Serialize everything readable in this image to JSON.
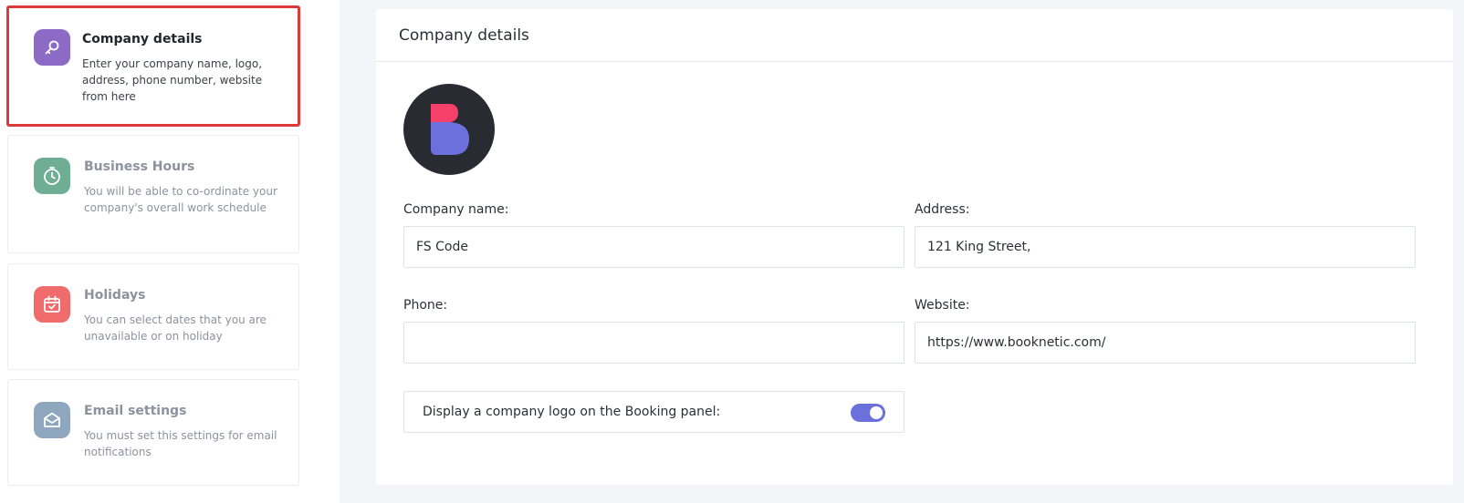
{
  "sidebar": {
    "items": [
      {
        "title": "Company details",
        "description": "Enter your company name, logo, address, phone number, website from here",
        "icon": "key-icon",
        "icon_color": "#8c6ac6",
        "active": true
      },
      {
        "title": "Business Hours",
        "description": "You will be able to co-ordinate your company's overall work schedule",
        "icon": "clock-icon",
        "icon_color": "#6fae94",
        "active": false
      },
      {
        "title": "Holidays",
        "description": "You can select dates that you are unavailable or on holiday",
        "icon": "calendar-check-icon",
        "icon_color": "#f06c6c",
        "active": false
      },
      {
        "title": "Email settings",
        "description": "You must set this settings for email notifications",
        "icon": "envelope-open-icon",
        "icon_color": "#8ea6be",
        "active": false
      }
    ]
  },
  "main": {
    "title": "Company details",
    "fields": {
      "company_name": {
        "label": "Company name:",
        "value": "FS Code"
      },
      "address": {
        "label": "Address:",
        "value": "121 King Street,"
      },
      "phone": {
        "label": "Phone:",
        "value": ""
      },
      "website": {
        "label": "Website:",
        "value": "https://www.booknetic.com/"
      }
    },
    "logo_toggle": {
      "label": "Display a company logo on the Booking panel:",
      "enabled": true
    }
  },
  "colors": {
    "active_border": "#dd3b3b",
    "toggle_on": "#6c70dc",
    "logo_background": "#292b33",
    "logo_pink": "#f5406a",
    "logo_purple": "#6c70dc"
  }
}
